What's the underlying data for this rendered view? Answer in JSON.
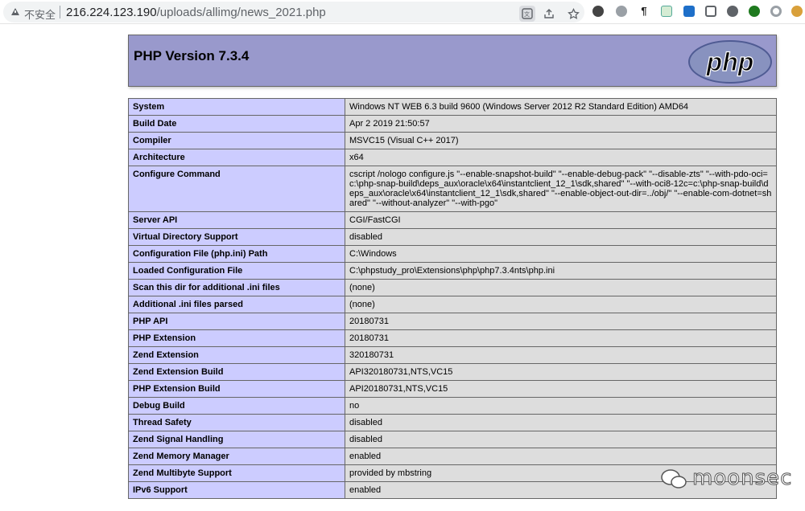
{
  "browser": {
    "security_label": "不安全",
    "url_host": "216.224.123.190",
    "url_path": "/uploads/allimg/news_2021.php",
    "toolbar_icons": [
      "translate-icon",
      "share-icon",
      "star-icon",
      "extension-icons"
    ]
  },
  "phpinfo": {
    "title": "PHP Version 7.3.4",
    "logo_text": "php",
    "rows": [
      {
        "label": "System",
        "value": "Windows NT WEB 6.3 build 9600 (Windows Server 2012 R2 Standard Edition) AMD64"
      },
      {
        "label": "Build Date",
        "value": "Apr 2 2019 21:50:57"
      },
      {
        "label": "Compiler",
        "value": "MSVC15 (Visual C++ 2017)"
      },
      {
        "label": "Architecture",
        "value": "x64"
      },
      {
        "label": "Configure Command",
        "value": "cscript /nologo configure.js \"--enable-snapshot-build\" \"--enable-debug-pack\" \"--disable-zts\" \"--with-pdo-oci=c:\\php-snap-build\\deps_aux\\oracle\\x64\\instantclient_12_1\\sdk,shared\" \"--with-oci8-12c=c:\\php-snap-build\\deps_aux\\oracle\\x64\\instantclient_12_1\\sdk,shared\" \"--enable-object-out-dir=../obj/\" \"--enable-com-dotnet=shared\" \"--without-analyzer\" \"--with-pgo\""
      },
      {
        "label": "Server API",
        "value": "CGI/FastCGI"
      },
      {
        "label": "Virtual Directory Support",
        "value": "disabled"
      },
      {
        "label": "Configuration File (php.ini) Path",
        "value": "C:\\Windows"
      },
      {
        "label": "Loaded Configuration File",
        "value": "C:\\phpstudy_pro\\Extensions\\php\\php7.3.4nts\\php.ini"
      },
      {
        "label": "Scan this dir for additional .ini files",
        "value": "(none)"
      },
      {
        "label": "Additional .ini files parsed",
        "value": "(none)"
      },
      {
        "label": "PHP API",
        "value": "20180731"
      },
      {
        "label": "PHP Extension",
        "value": "20180731"
      },
      {
        "label": "Zend Extension",
        "value": "320180731"
      },
      {
        "label": "Zend Extension Build",
        "value": "API320180731,NTS,VC15"
      },
      {
        "label": "PHP Extension Build",
        "value": "API20180731,NTS,VC15"
      },
      {
        "label": "Debug Build",
        "value": "no"
      },
      {
        "label": "Thread Safety",
        "value": "disabled"
      },
      {
        "label": "Zend Signal Handling",
        "value": "disabled"
      },
      {
        "label": "Zend Memory Manager",
        "value": "enabled"
      },
      {
        "label": "Zend Multibyte Support",
        "value": "provided by mbstring"
      },
      {
        "label": "IPv6 Support",
        "value": "enabled"
      }
    ]
  },
  "watermark": {
    "text": "moonsec"
  },
  "colors": {
    "header_bg": "#9999cc",
    "label_bg": "#ccccff",
    "value_bg": "#dddddd"
  }
}
